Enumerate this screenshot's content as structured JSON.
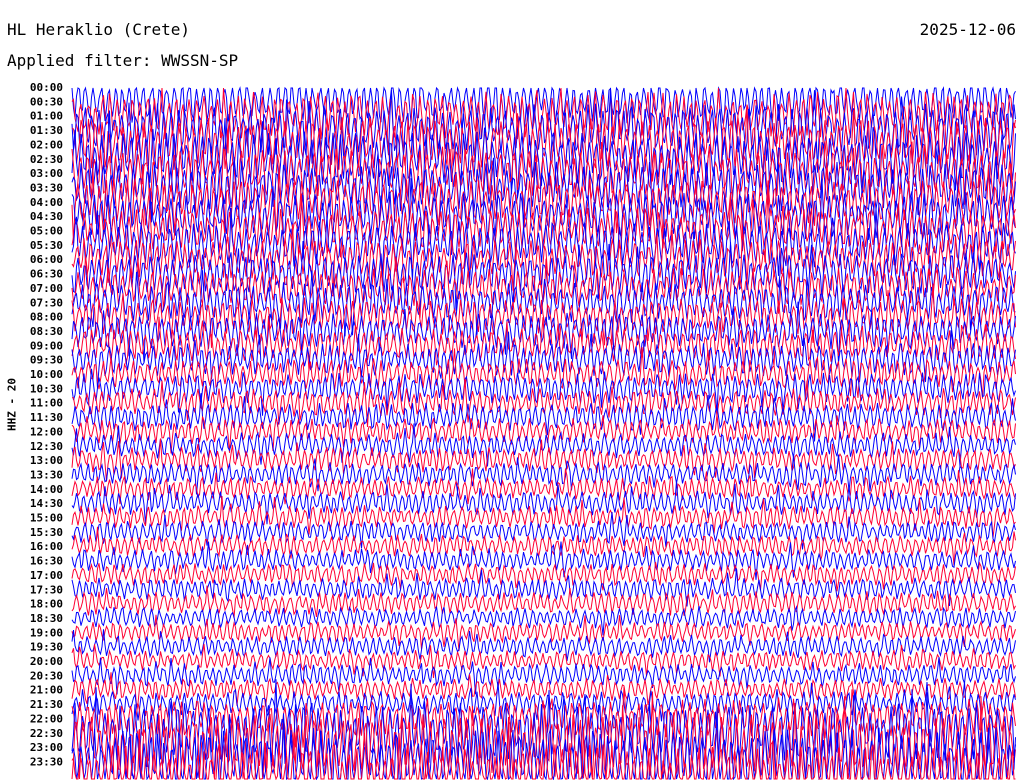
{
  "header": {
    "station": "HL Heraklio (Crete)",
    "date": "2025-12-06",
    "filter": "Applied filter: WWSSN-SP",
    "channel": "HHZ - 20"
  },
  "chart_data": {
    "type": "line",
    "title": "HL Heraklio (Crete)",
    "subtitle": "Applied filter: WWSSN-SP",
    "ylabel": "HHZ - 20",
    "y_tick_labels": [
      "00:00",
      "00:30",
      "01:00",
      "01:30",
      "02:00",
      "02:30",
      "03:00",
      "03:30",
      "04:00",
      "04:30",
      "05:00",
      "05:30",
      "06:00",
      "06:30",
      "07:00",
      "07:30",
      "08:00",
      "08:30",
      "09:00",
      "09:30",
      "10:00",
      "10:30",
      "11:00",
      "11:30",
      "12:00",
      "12:30",
      "13:00",
      "13:30",
      "14:00",
      "14:30",
      "15:00",
      "15:30",
      "16:00",
      "16:30",
      "17:00",
      "17:30",
      "18:00",
      "18:30",
      "19:00",
      "19:30",
      "20:00",
      "20:30",
      "21:00",
      "21:30",
      "22:00",
      "22:30",
      "23:00",
      "23:30"
    ],
    "trace_colors": [
      "#0000ff",
      "#ff0033"
    ],
    "trace_amplitude": [
      1.6,
      1.7,
      1.9,
      1.9,
      1.9,
      1.8,
      1.8,
      1.7,
      1.7,
      1.6,
      1.6,
      1.5,
      1.5,
      1.4,
      1.4,
      1.3,
      1.3,
      1.2,
      1.2,
      1.1,
      1.1,
      1.0,
      1.0,
      0.9,
      0.9,
      0.9,
      0.85,
      0.85,
      0.85,
      0.85,
      0.8,
      0.8,
      0.8,
      0.8,
      0.8,
      0.8,
      0.75,
      0.75,
      0.75,
      0.75,
      0.8,
      0.8,
      0.9,
      1.4,
      2.2,
      2.4,
      2.4,
      2.4
    ],
    "grid": false,
    "legend": "none"
  }
}
